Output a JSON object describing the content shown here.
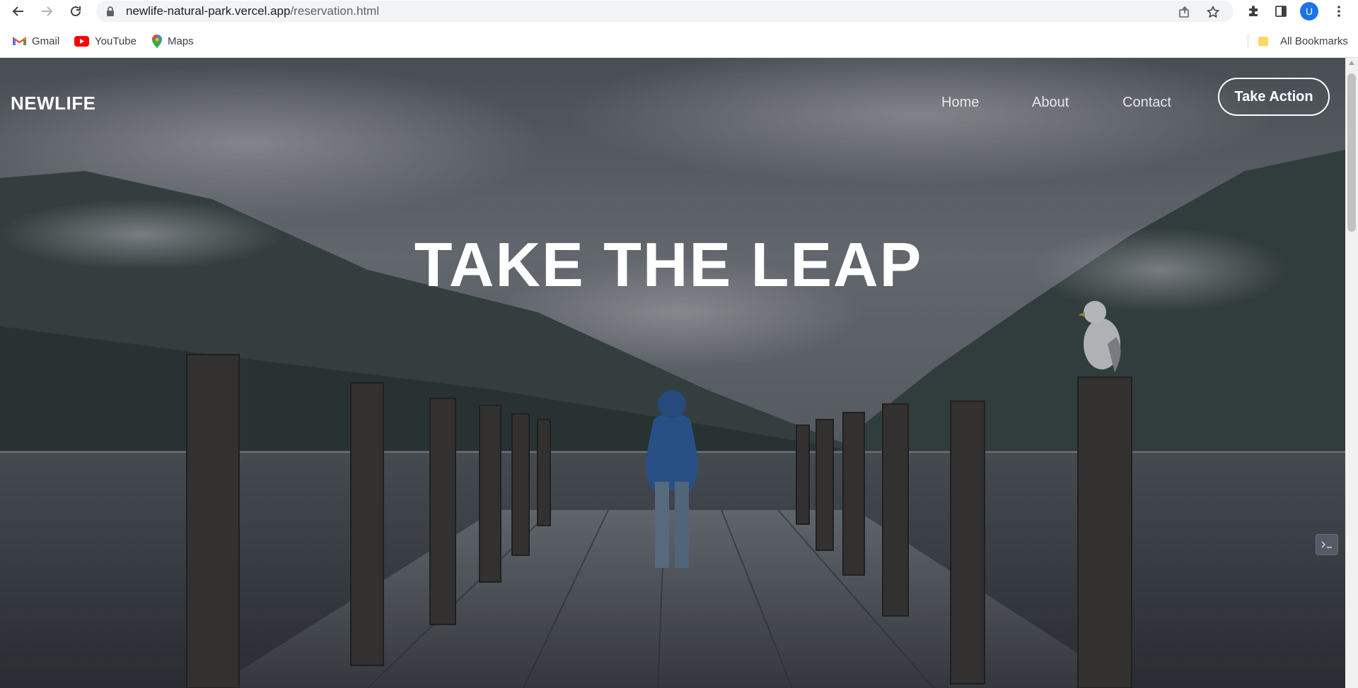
{
  "browser": {
    "url_host": "newlife-natural-park.vercel.app",
    "url_path": "/reservation.html",
    "profile_initial": "U",
    "bookmarks": [
      {
        "label": "Gmail",
        "icon": "gmail-icon"
      },
      {
        "label": "YouTube",
        "icon": "youtube-icon"
      },
      {
        "label": "Maps",
        "icon": "maps-icon"
      }
    ],
    "all_bookmarks_label": "All Bookmarks"
  },
  "header": {
    "brand": "NEWLIFE",
    "nav": [
      "Home",
      "About",
      "Contact"
    ],
    "cta_label": "Take Action"
  },
  "hero": {
    "headline": "TAKE THE LEAP",
    "background": "misty mountain lake with wooden pier, person in blue hoodie and seagull on post"
  },
  "colors": {
    "accent_blue": "#1a73e8",
    "hoodie_blue": "#2e63a8",
    "text_light": "#ffffff"
  }
}
